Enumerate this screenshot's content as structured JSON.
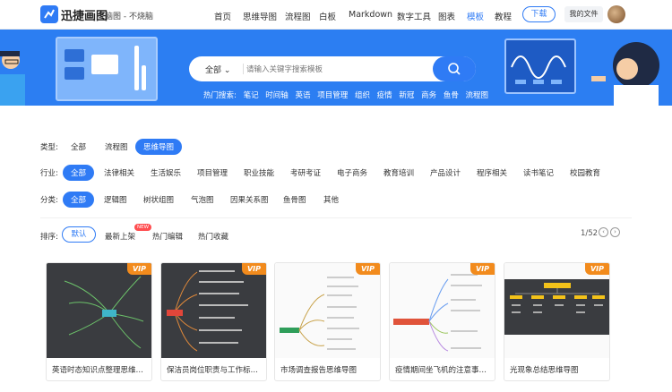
{
  "brand": {
    "name": "迅捷画图",
    "subtitle": "脑图 - 不烧脑"
  },
  "nav": [
    "首页",
    "思维导图",
    "流程图",
    "白板",
    "Markdown",
    "数字工具",
    "图表",
    "模板",
    "教程"
  ],
  "nav_active": "模板",
  "header": {
    "download": "下载",
    "my_files": "我的文件"
  },
  "search": {
    "category": "全部 ⌄",
    "placeholder": "请输入关键字搜索模板"
  },
  "hot_search": {
    "label": "热门搜索:",
    "terms": [
      "笔记",
      "时间轴",
      "英语",
      "项目管理",
      "组织",
      "疫情",
      "新冠",
      "商务",
      "鱼骨",
      "流程图"
    ]
  },
  "filters": {
    "type": {
      "label": "类型:",
      "options": [
        "全部",
        "流程图",
        "思维导图"
      ],
      "selected": "思维导图"
    },
    "industry": {
      "label": "行业:",
      "options": [
        "全部",
        "法律相关",
        "生活娱乐",
        "项目管理",
        "职业技能",
        "考研考证",
        "电子商务",
        "教育培训",
        "产品设计",
        "程序相关",
        "读书笔记",
        "校园教育"
      ],
      "selected": "全部"
    },
    "category": {
      "label": "分类:",
      "options": [
        "全部",
        "逻辑图",
        "树状组图",
        "气泡图",
        "因果关系图",
        "鱼骨图",
        "其他"
      ],
      "selected": "全部"
    }
  },
  "sort": {
    "label": "排序:",
    "options": [
      "默认",
      "最新上架",
      "热门编辑",
      "热门收藏"
    ],
    "selected": "默认",
    "new_badge": "NEW"
  },
  "pager": {
    "text": "1/52",
    "prev": "‹",
    "next": "›"
  },
  "vip_label": "VIP",
  "templates": [
    {
      "title": "英语时态知识点整理思维导图",
      "theme": "dark"
    },
    {
      "title": "保洁员岗位职责与工作标准思...",
      "theme": "dark"
    },
    {
      "title": "市场调查报告思维导图",
      "theme": "light"
    },
    {
      "title": "疫情期间坐飞机的注意事项思...",
      "theme": "light"
    },
    {
      "title": "光现象总结思维导图",
      "theme": "light"
    }
  ],
  "colors": {
    "accent": "#2f7bf5",
    "vip": "#f28b1d",
    "hero": "#2c7ef2"
  }
}
